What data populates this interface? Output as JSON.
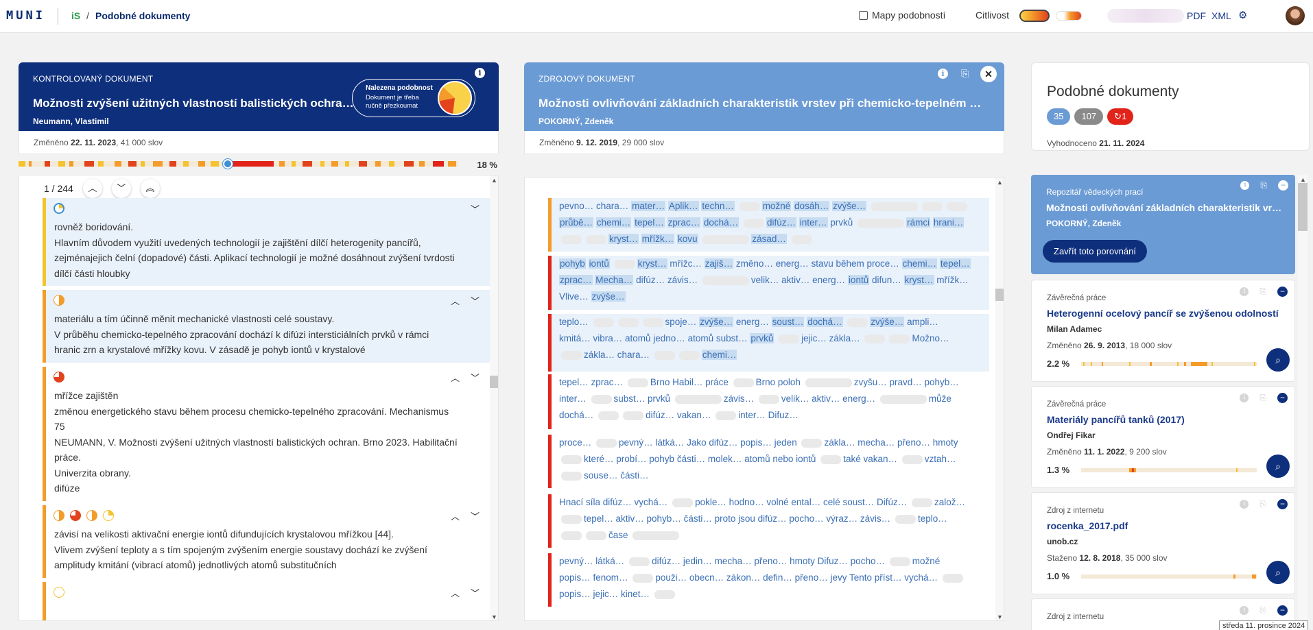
{
  "topbar": {
    "logo": "MUNI",
    "is_logo": "iS",
    "slash": "/",
    "crumb": "Podobné dokumenty",
    "maps_label": "Mapy podobností",
    "sensitivity_label": "Citlivost",
    "pdf": "PDF",
    "xml": "XML"
  },
  "left_card": {
    "kicker": "KONTROLOVANÝ DOKUMENT",
    "title": "Možnosti zvýšení užitných vlastností balistických ochran (Habilitační práce)",
    "author": "Neumann, Vlastimil",
    "found_heading": "Nalezena podobnost",
    "found_sub": "Dokument je třeba ručně přezkoumat",
    "changed_prefix": "Změněno",
    "changed_date": "22. 11. 2023",
    "words": ", 41 000 slov",
    "similarity_pct": "18 %",
    "page_indicator": "1 / 244"
  },
  "left_segments": [
    {
      "lines": [
        "rovněž boridování.",
        "Hlavním důvodem využití uvedených technologií je zajištění dílčí heterogenity pancířů,",
        "zejménajejich čelní (dopadové) části. Aplikací technologií je možné dosáhnout zvýšení tvrdosti",
        "dílčí části hloubky"
      ]
    },
    {
      "lines": [
        "materiálu a tím účinně měnit mechanické vlastnosti celé soustavy.",
        "V průběhu chemicko-tepelného zpracování dochází k difúzi intersticiálních prvků v rámci",
        "hranic zrn a krystalové mřížky kovu. V zásadě je pohyb iontů v krystalové"
      ]
    },
    {
      "lines": [
        "mřížce zajištěn",
        "změnou energetického stavu během procesu chemicko-tepelného zpracování. Mechanismus",
        "75",
        "NEUMANN, V. Možnosti zvýšení užitných vlastností balistických ochran. Brno 2023. Habilitační",
        "práce.",
        "Univerzita obrany.",
        "difúze"
      ]
    },
    {
      "lines": [
        "závisí na velikosti aktivační energie iontů difundujících krystalovou mřížkou [44].",
        "Vlivem zvýšení teploty a s tím spojeným zvýšením energie soustavy dochází ke zvýšení",
        "amplitudy kmitání (vibrací atomů) jednotlivých atomů substitučních"
      ]
    }
  ],
  "mid_card": {
    "kicker": "ZDROJOVÝ DOKUMENT",
    "title": "Možnosti ovlivňování základních charakteristik vrstev při chemicko-tepelném zpracování",
    "author": "POKORNÝ, Zdeněk",
    "changed_prefix": "Změněno",
    "changed_date": "9. 12. 2019",
    "words": ", 29 000 slov"
  },
  "mid_segments": [
    [
      "pevno… chara…",
      "*mater…",
      "*Aplik…",
      "*techn…",
      "~",
      "*možné",
      "*dosáh…",
      "*zvýše…",
      "~~",
      "~",
      "~",
      "/",
      "*průbě…",
      "*chemi…",
      "*tepel…",
      "*zprac…",
      "*dochá…",
      "~",
      "*difúz…",
      "*inter…",
      "prvků",
      "~~",
      "*rámci",
      "*hrani…",
      "/",
      "~",
      "~",
      "*kryst…",
      "*mřížk…",
      "*kovu",
      "~~",
      "*zásad…",
      "~"
    ],
    [
      "*pohyb",
      "*iontů",
      "~",
      "*kryst…",
      "mřížc…",
      "*zajiš…",
      "změno… energ… stavu během proce…",
      "*chemi…",
      "*tepel…",
      "/",
      "*zprac…",
      "*Mecha…",
      "difúz… závis…",
      "~~",
      "velik… aktiv… energ…",
      "*iontů",
      "difun…",
      "*kryst…",
      "mřížk…",
      "/",
      "Vlive…",
      "*zvýše…"
    ],
    [
      "teplo…",
      "~",
      "~",
      "~",
      "spoje…",
      "*zvýše…",
      "energ…",
      "*soust…",
      "*dochá…",
      "~",
      "*zvýše…",
      "ampli…",
      "/",
      "kmitá… vibra… atomů jedno… atomů subst…",
      "*prvků",
      "~",
      "jejic… zákla…",
      "~",
      "~",
      "Možno…",
      "/",
      "~",
      "zákla… chara…",
      "~",
      "~",
      "*chemi…"
    ],
    [
      "tepel… zprac…",
      "~",
      "Brno Habil… práce",
      "~",
      "Brno poloh",
      "~~",
      "zvyšu… pravd… pohyb…",
      "/",
      "inter…",
      "~",
      "subst… prvků",
      "~~",
      "závis…",
      "~",
      "velik… aktiv… energ…",
      "~~",
      "může",
      "/",
      "dochá…",
      "~",
      "~",
      "difúz… vakan…",
      "~",
      "inter… Difuz…"
    ],
    [
      "proce…",
      "~",
      "pevný… látká…",
      "Jako difúz… popis… jeden",
      "~",
      "zákla… mecha… přeno… hmoty",
      "/",
      "~",
      "které… probí… pohyb části… molek… atomů nebo iontů",
      "~",
      "také vakan…",
      "~",
      "vztah…",
      "/",
      "~",
      "souse… části…"
    ],
    [
      "Hnací síla difúz… vychá…",
      "~",
      "pokle… hodno… volné ental… celé soust… Difúz…",
      "~",
      "založ…",
      "/",
      "~",
      "tepel… aktiv… pohyb… části… proto jsou difúz… pocho… výraz… závis…",
      "~",
      "teplo…",
      "/",
      "~",
      "~",
      "čase",
      "~~"
    ],
    [
      "pevný… látká…",
      "~",
      "difúz… jedin… mecha… přeno… hmoty Difuz… pocho…",
      "~",
      "možné",
      "/",
      "popis… fenom…",
      "~",
      "použi… obecn… zákon… defin… přeno… jevy Tento příst… vychá…",
      "~",
      "/",
      "popis… jejic… kinet…",
      "~"
    ]
  ],
  "right_head": {
    "title": "Podobné dokumenty",
    "count_blue": "35",
    "count_gray": "107",
    "count_red": "1",
    "evaluated_prefix": "Vyhodnoceno",
    "evaluated_date": "21. 11. 2024"
  },
  "repo_card": {
    "kicker": "Repozitář vědeckých prací",
    "title": "Možnosti ovlivňování základních charakteristik vrstev při chemicko-tepelném zpracování",
    "author": "POKORNÝ, Zdeněk",
    "close_btn": "Zavřít toto porovnání"
  },
  "doc_cards": [
    {
      "kind": "Závěrečná práce",
      "title": "Heterogenní ocelový pancíř se zvýšenou odolností",
      "author": "Milan Adamec",
      "meta_prefix": "Změněno",
      "meta_date": "26. 9. 2013",
      "meta_words": ", 18 000 slov",
      "pct": "2.2 %",
      "pct_value": 2.2
    },
    {
      "kind": "Závěrečná práce",
      "title": "Materiály pancířů tanků (2017)",
      "author": "Ondřej Fikar",
      "meta_prefix": "Změněno",
      "meta_date": "11. 1. 2022",
      "meta_words": ", 9 200 slov",
      "pct": "1.3 %",
      "pct_value": 1.3
    },
    {
      "kind": "Zdroj z internetu",
      "title": "rocenka_2017.pdf",
      "author": "unob.cz",
      "meta_prefix": "Staženo",
      "meta_date": "12. 8. 2018",
      "meta_words": ", 35 000 slov",
      "pct": "1.0 %",
      "pct_value": 1.0
    },
    {
      "kind": "Zdroj z internetu",
      "title": "",
      "author": "",
      "meta_prefix": "",
      "meta_date": "",
      "meta_words": "",
      "pct": "",
      "pct_value": 0
    }
  ],
  "tooltip": "středa 11. prosince 2024",
  "colors": {
    "navy": "#0e2f7c",
    "light_blue": "#6b9bd5",
    "yellow": "#f5c230",
    "orange": "#f39c2b",
    "red": "#e2231a"
  }
}
